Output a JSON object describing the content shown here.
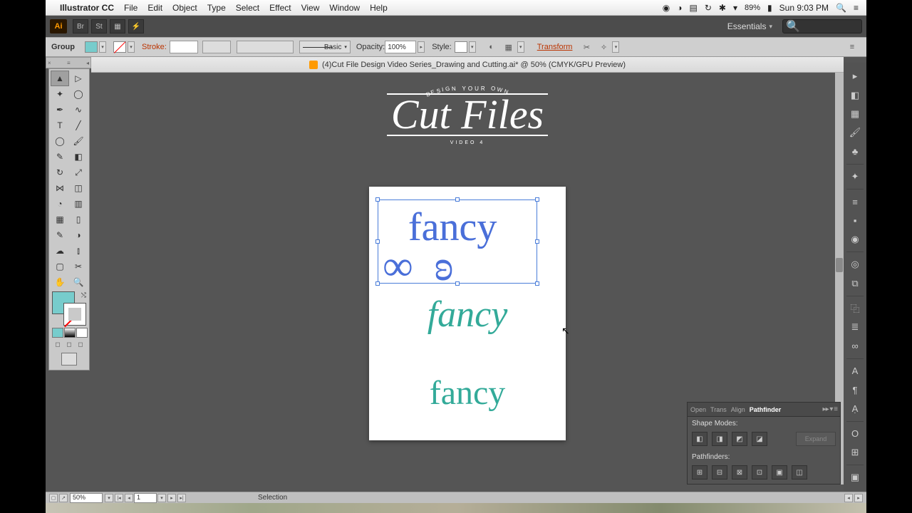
{
  "menubar": {
    "app": "Illustrator CC",
    "items": [
      "File",
      "Edit",
      "Object",
      "Type",
      "Select",
      "Effect",
      "View",
      "Window",
      "Help"
    ],
    "battery": "89%",
    "clock": "Sun 9:03 PM"
  },
  "apptoolbar": {
    "workspace": "Essentials"
  },
  "controlbar": {
    "selection": "Group",
    "stroke_label": "Stroke:",
    "brushdef": "Basic",
    "opacity_label": "Opacity:",
    "opacity_value": "100%",
    "style_label": "Style:",
    "transform": "Transform"
  },
  "document": {
    "title": "(4)Cut File Design Video Series_Drawing and Cutting.ai* @ 50% (CMYK/GPU Preview)"
  },
  "artwork": {
    "arc": "DESIGN YOUR OWN",
    "title": "Cut Files",
    "subtitle": "VIDEO 4",
    "word1": "fancy",
    "word2": "fancy",
    "word3": "fancy"
  },
  "pathfinder": {
    "tabs": [
      "Open",
      "Trans",
      "Align",
      "Pathfinder"
    ],
    "shape_label": "Shape Modes:",
    "path_label": "Pathfinders:",
    "expand": "Expand"
  },
  "status": {
    "zoom": "50%",
    "artboard": "1",
    "tool": "Selection"
  }
}
